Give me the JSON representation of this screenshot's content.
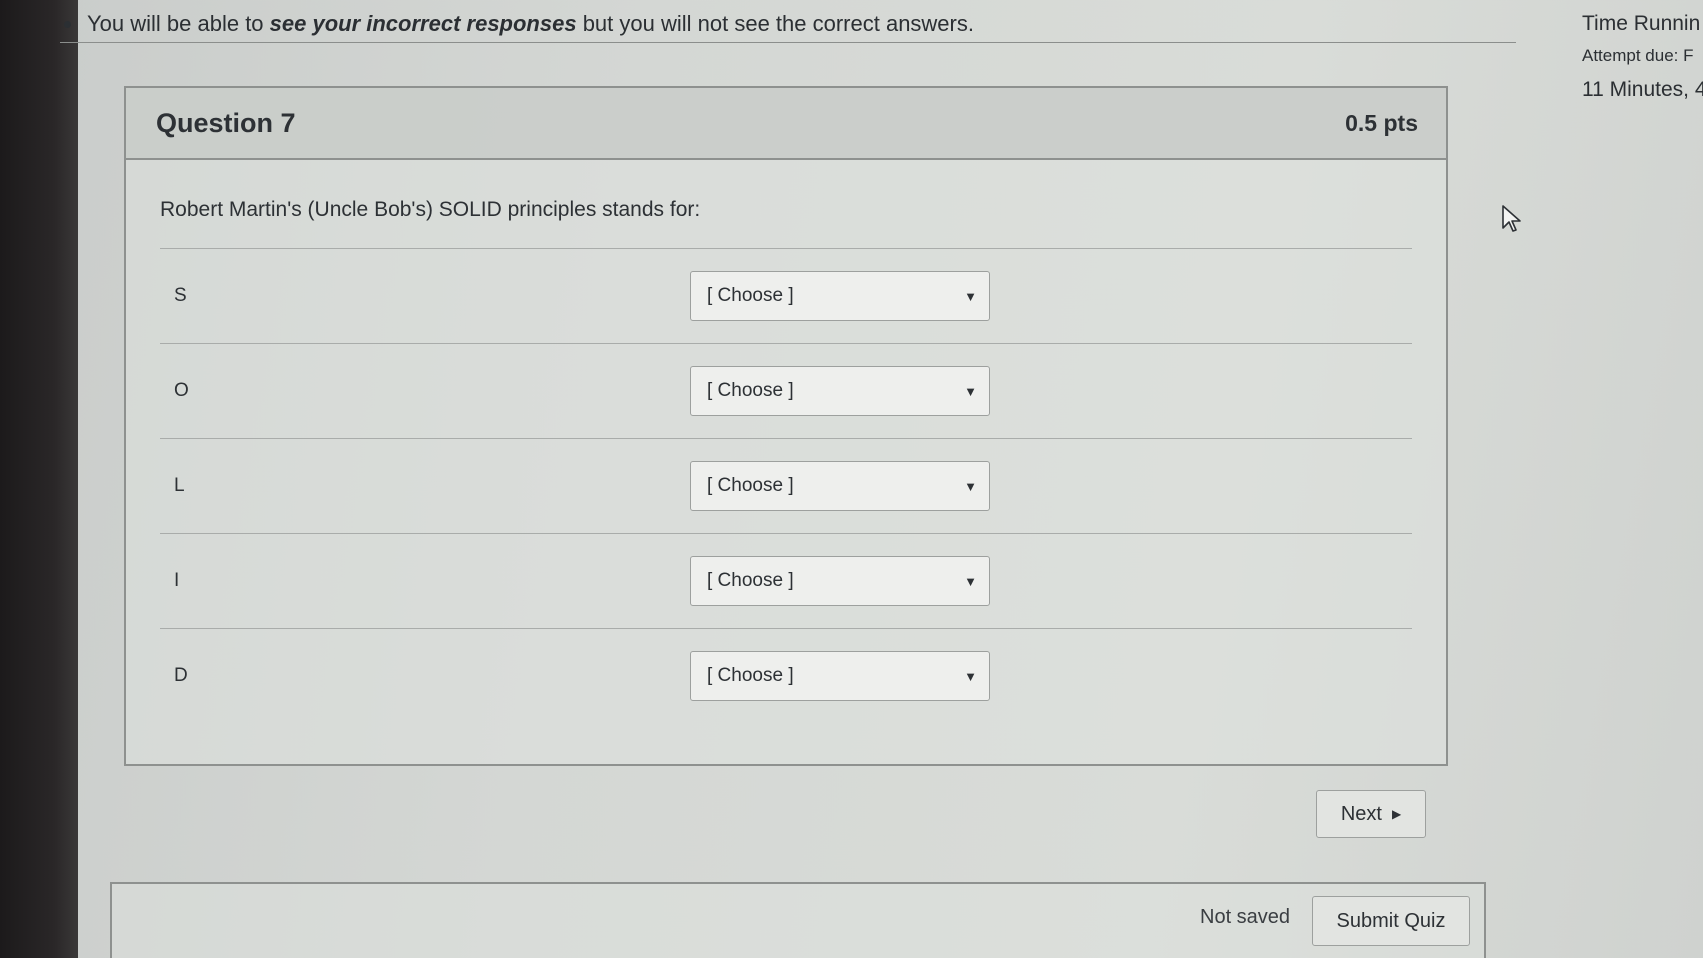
{
  "notice": {
    "prefix": "You will be able to ",
    "emphasis": "see your incorrect responses",
    "suffix": " but you will not see the correct answers."
  },
  "side_info": {
    "time_running": "Time Runnin",
    "attempt_due": "Attempt due: F",
    "minutes": "11 Minutes, 4"
  },
  "question": {
    "title": "Question 7",
    "points": "0.5 pts",
    "text": "Robert Martin's (Uncle Bob's) SOLID principles stands for:",
    "rows": [
      {
        "letter": "S",
        "selected": "[ Choose ]"
      },
      {
        "letter": "O",
        "selected": "[ Choose ]"
      },
      {
        "letter": "L",
        "selected": "[ Choose ]"
      },
      {
        "letter": "I",
        "selected": "[ Choose ]"
      },
      {
        "letter": "D",
        "selected": "[ Choose ]"
      }
    ]
  },
  "actions": {
    "next_label": "Next",
    "save_status": "Not saved",
    "submit_label": "Submit Quiz"
  },
  "icons": {
    "dropdown": "caret-down-icon",
    "next": "caret-right-icon",
    "pointer": "mouse-cursor-icon"
  }
}
